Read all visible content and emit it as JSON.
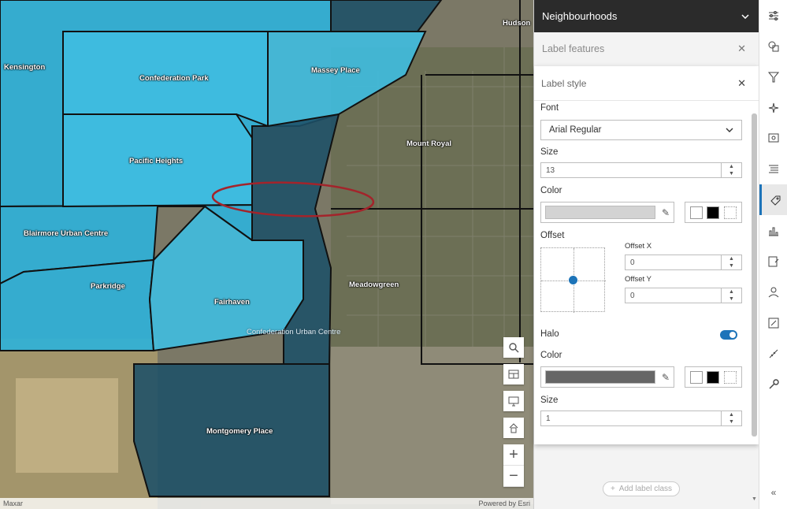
{
  "map": {
    "labels": {
      "kensington": "Kensington",
      "confederation_park": "Confederation Park",
      "massey_place": "Massey Place",
      "hudson": "Hudson",
      "pacific_heights": "Pacific Heights",
      "mount_royal": "Mount Royal",
      "blairmore": "Blairmore Urban Centre",
      "parkridge": "Parkridge",
      "fairhaven": "Fairhaven",
      "meadowgreen": "Meadowgreen",
      "confederation_uc": "Confederation Urban Centre",
      "montgomery": "Montgomery Place"
    },
    "attribution_left": "Maxar",
    "attribution_right": "Powered by Esri",
    "colors": {
      "light_fill": "#2fb1d8",
      "dark_fill": "#1d5068",
      "outline": "#111111",
      "annotation": "#a3242b"
    }
  },
  "panel": {
    "layer_title": "Neighbourhoods",
    "label_features": "Label features",
    "label_style": {
      "title": "Label style",
      "font_label": "Font",
      "font_value": "Arial Regular",
      "size_label": "Size",
      "size_value": "13",
      "color_label": "Color",
      "color_value": "#d3d3d3",
      "offset_label": "Offset",
      "offset_x_label": "Offset X",
      "offset_x_value": "0",
      "offset_y_label": "Offset Y",
      "offset_y_value": "0",
      "halo_label": "Halo",
      "halo_enabled": true,
      "halo_color_label": "Color",
      "halo_color_value": "#666666",
      "halo_size_label": "Size",
      "halo_size_value": "1"
    },
    "add_label_class": "Add label class"
  },
  "rail": {
    "icons": [
      "properties-icon",
      "styles-icon",
      "filter-icon",
      "effects-icon",
      "popups-icon",
      "fields-icon",
      "labels-icon",
      "charts-icon",
      "configure-icon",
      "sketch-icon",
      "edit-icon",
      "measure-icon",
      "wrench-icon"
    ],
    "active": "labels-icon",
    "accent": "#1d74b9"
  }
}
